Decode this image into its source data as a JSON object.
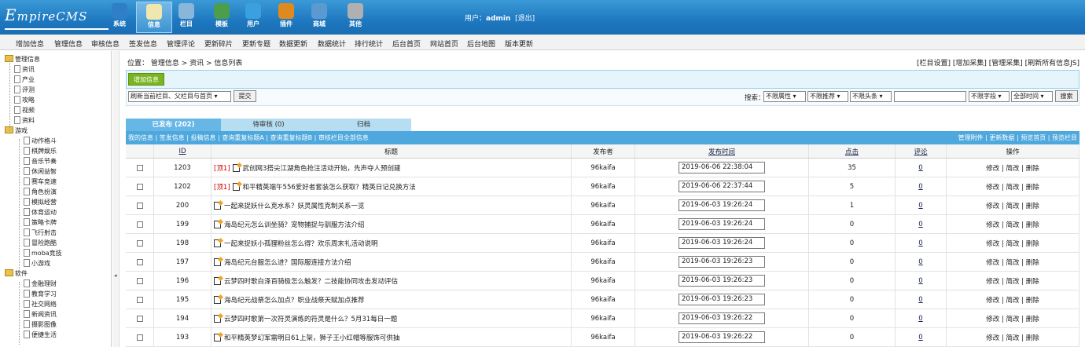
{
  "logo": {
    "text_e": "E",
    "text_rest": "mpireCMS"
  },
  "topnav": [
    {
      "label": "系统",
      "icon": "globe-icon",
      "color": "#2f7fc6"
    },
    {
      "label": "信息",
      "icon": "document-pen-icon",
      "color": "#f0e6b0"
    },
    {
      "label": "栏目",
      "icon": "folder-icon",
      "color": "#8ab6da"
    },
    {
      "label": "模板",
      "icon": "monitor-icon",
      "color": "#4c9e4c"
    },
    {
      "label": "用户",
      "icon": "user-icon",
      "color": "#3aa0e0"
    },
    {
      "label": "插件",
      "icon": "tools-icon",
      "color": "#e08a1e"
    },
    {
      "label": "商城",
      "icon": "shop-icon",
      "color": "#5a9ad0"
    },
    {
      "label": "其他",
      "icon": "gear-icon",
      "color": "#b0b0b0"
    }
  ],
  "user": {
    "prefix": "用户：",
    "name": "admin",
    "logout": "[退出]"
  },
  "submenu": [
    "增加信息",
    "管理信息",
    "审核信息",
    "签发信息",
    "管理评论",
    "更新碎片",
    "更新专题",
    "数据更新",
    "数据统计",
    "排行统计",
    "后台首页",
    "网站首页",
    "后台地图",
    "版本更新"
  ],
  "tree": {
    "root": "管理信息",
    "cat1": [
      "资讯",
      "产业",
      "评测",
      "攻略",
      "视频",
      "资料"
    ],
    "group_game": "游戏",
    "game": [
      "动作格斗",
      "棋牌娱乐",
      "音乐节奏",
      "休闲益智",
      "赛车竞速",
      "角色扮演",
      "模拟经营",
      "体育运动",
      "策略卡牌",
      "飞行射击",
      "冒险跑酷",
      "moba竞技",
      "小游戏"
    ],
    "group_soft": "软件",
    "soft": [
      "金融理财",
      "教育学习",
      "社交网络",
      "新闻资讯",
      "摄影图像",
      "便捷生活"
    ]
  },
  "breadcrumb": "位置： 管理信息 > 资讯 > 信息列表",
  "breadcrumb_right": "[栏目设置] [增加采集] [管理采集] [刷新所有信息JS]",
  "add_button": "增加信息",
  "refresh_select": "刷新当前栏目、父栏目与首页",
  "submit_label": "提交",
  "search": {
    "label": "搜索：",
    "attr": "不限属性",
    "rec": "不限推荐",
    "head": "不限头条",
    "field": "不限字段",
    "time": "全部时间",
    "button": "搜索",
    "value": ""
  },
  "tabs": [
    "已发布 (202)",
    "待审核 (0)",
    "归档"
  ],
  "links_left": "我的信息 | 签发信息 | 投稿信息 | 查询重复标题A | 查询重复标题B | 审核栏目全部信息",
  "links_right": "管理附件 | 更新数据 | 预览首页 | 预览栏目",
  "headers": {
    "id": "ID",
    "title": "标题",
    "author": "发布者",
    "time": "发布时间",
    "clicks": "点击",
    "comments": "评论",
    "ops": "操作"
  },
  "op_labels": "修改 | 简改 | 删除",
  "rows": [
    {
      "id": "1203",
      "top": "[顶1]",
      "title": "武创网3搭尖江湖角色抢注活动开始，先声夺人预创建",
      "author": "96kaifa",
      "time": "2019-06-06 22:38:04",
      "clicks": "35",
      "comments": "0"
    },
    {
      "id": "1202",
      "top": "[顶1]",
      "title": "和平精英端午556爱好者套装怎么获取？精英日记兑换方法",
      "author": "96kaifa",
      "time": "2019-06-06 22:37:44",
      "clicks": "5",
      "comments": "0"
    },
    {
      "id": "200",
      "top": "",
      "title": "一起来捉妖什么克水系？妖灵属性克制关系一览",
      "author": "96kaifa",
      "time": "2019-06-03 19:26:24",
      "clicks": "1",
      "comments": "0"
    },
    {
      "id": "199",
      "top": "",
      "title": "海岛纪元怎么训坐骑？宠物捕捉与驯服方法介绍",
      "author": "96kaifa",
      "time": "2019-06-03 19:26:24",
      "clicks": "0",
      "comments": "0"
    },
    {
      "id": "198",
      "top": "",
      "title": "一起来捉妖小孤狸粉丝怎么得？欢乐周末礼活动说明",
      "author": "96kaifa",
      "time": "2019-06-03 19:26:24",
      "clicks": "0",
      "comments": "0"
    },
    {
      "id": "197",
      "top": "",
      "title": "海岛纪元台服怎么进？国际服连接方法介绍",
      "author": "96kaifa",
      "time": "2019-06-03 19:26:23",
      "clicks": "0",
      "comments": "0"
    },
    {
      "id": "196",
      "top": "",
      "title": "云梦四时歌白泽百骑极怎么触发？二技能协同攻击发动评估",
      "author": "96kaifa",
      "time": "2019-06-03 19:26:23",
      "clicks": "0",
      "comments": "0"
    },
    {
      "id": "195",
      "top": "",
      "title": "海岛纪元战祭怎么加点？职业战祭天赋加点推荐",
      "author": "96kaifa",
      "time": "2019-06-03 19:26:23",
      "clicks": "0",
      "comments": "0"
    },
    {
      "id": "194",
      "top": "",
      "title": "云梦四时歌第一次符灵演练的符灵是什么？5月31每日一题",
      "author": "96kaifa",
      "time": "2019-06-03 19:26:22",
      "clicks": "0",
      "comments": "0"
    },
    {
      "id": "193",
      "top": "",
      "title": "和平精英梦幻军需明日61上架，狮子王小红帽等服饰可供抽",
      "author": "96kaifa",
      "time": "2019-06-03 19:26:22",
      "clicks": "0",
      "comments": "0"
    }
  ]
}
